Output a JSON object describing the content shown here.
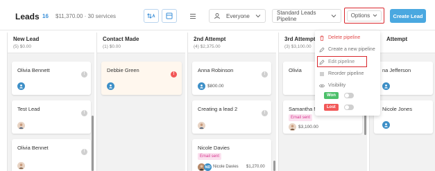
{
  "header": {
    "title": "Leads",
    "count": "16",
    "summary": "$11,370.00 · 30 services",
    "owner_select": "Everyone",
    "pipeline_select": "Standard Leads Pipeline",
    "options_label": "Options",
    "create_label": "Create Lead"
  },
  "columns": [
    {
      "title": "New Lead",
      "sub": "(5) $0.00"
    },
    {
      "title": "Contact Made",
      "sub": "(1) $0.00"
    },
    {
      "title": "2nd Attempt",
      "sub": "(4) $2,375.00"
    },
    {
      "title": "3rd Attempt",
      "sub": "(3) $3,100.00"
    },
    {
      "title": "Attempt",
      "sub": ""
    }
  ],
  "cards": {
    "c1": {
      "name": "Olivia Bennett"
    },
    "c2": {
      "name": "Test Lead"
    },
    "c3": {
      "name": "Olivia Bennet"
    },
    "c4": {
      "name": "Debbie Green"
    },
    "c5": {
      "name": "Anna Robinson",
      "amount": "$800.00"
    },
    "c6": {
      "name": "Creating a lead 2"
    },
    "c7": {
      "name": "Nicole Davies",
      "tag": "Email sent",
      "initials": "ND",
      "owner": "Nicole Davies",
      "amount": "$1,270.00"
    },
    "c8": {
      "name": "Olivia"
    },
    "c9": {
      "name": "Samantha Mi",
      "tag": "Email sent",
      "amount": "$3,100.00"
    },
    "c10": {
      "name": "na Jefferson"
    },
    "c11": {
      "name": "Nicole Jones"
    }
  },
  "dropdown": {
    "delete": "Delete pipeline",
    "create": "Create a new pipeline",
    "edit": "Edit pipeline",
    "reorder": "Reorder pipeline",
    "visibility": "Visibility",
    "won": "Won",
    "lost": "Lost"
  },
  "colors": {
    "accent": "#4aa8e0",
    "danger": "#e24b4b",
    "won": "#4cc06a",
    "lost": "#f25858"
  }
}
